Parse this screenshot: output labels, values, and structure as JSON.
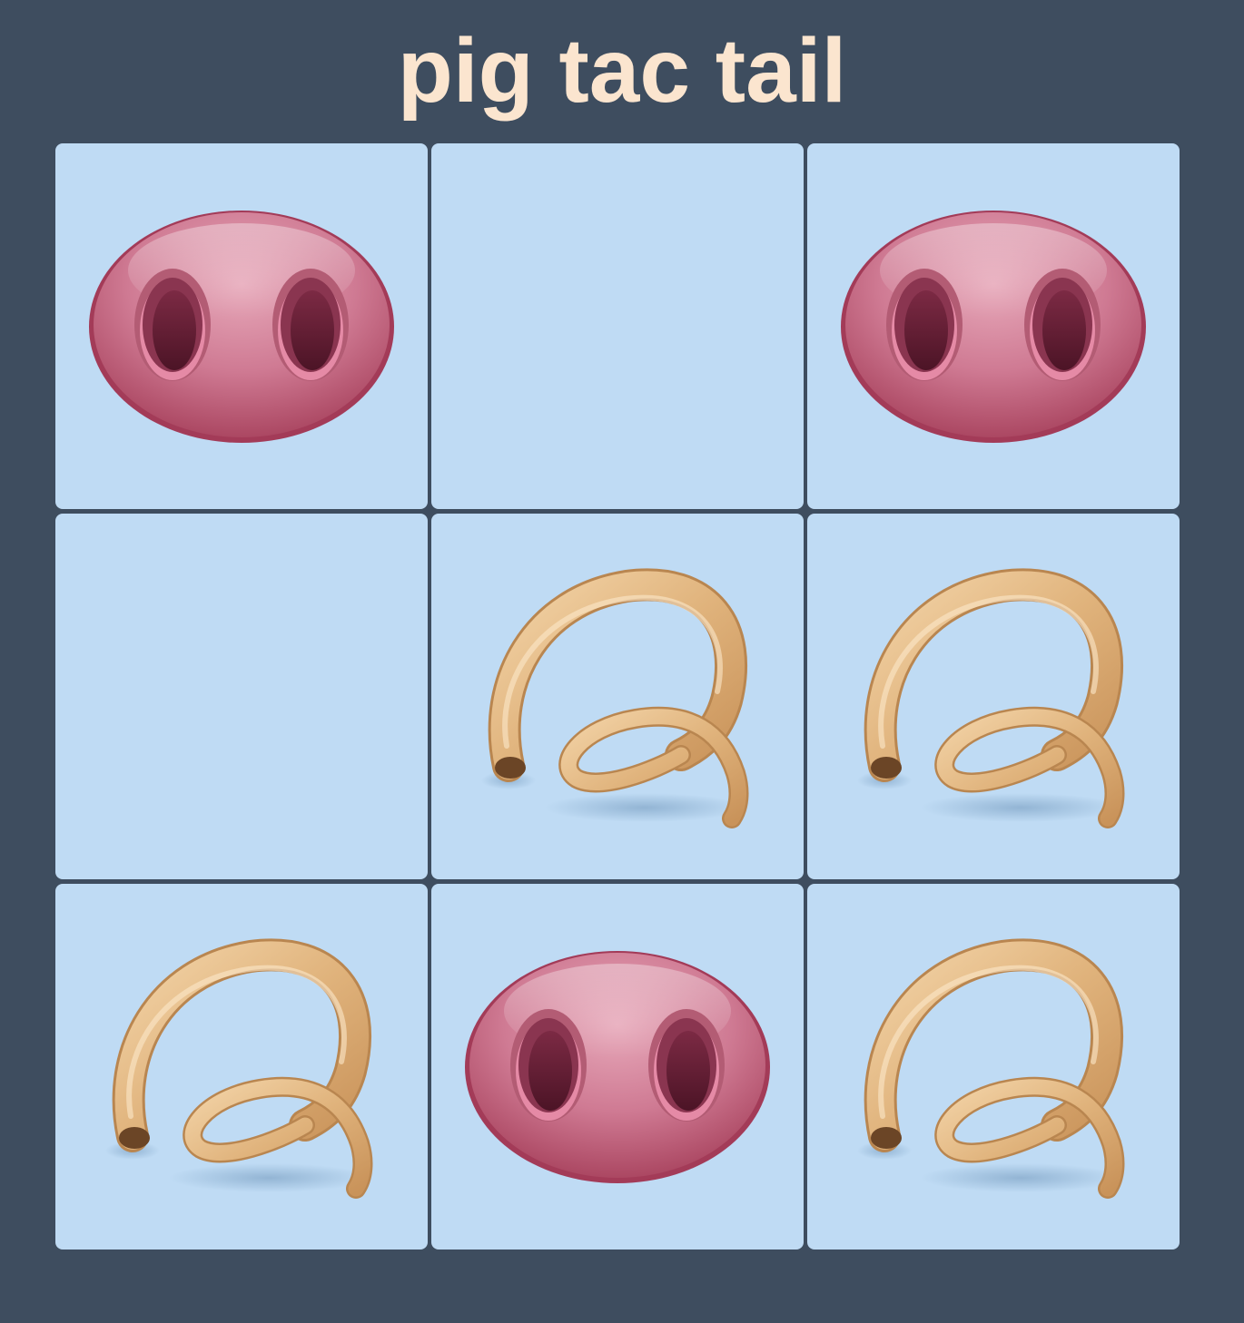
{
  "title": "pig tac tail",
  "colors": {
    "background": "#3e4d5f",
    "title": "#fbe5cf",
    "cell": "#bfdbf4",
    "snout": "#d4809a",
    "tail": "#e2b987"
  },
  "pieces": {
    "snout": "pig-snout-icon",
    "tail": "pig-tail-icon"
  },
  "board": [
    [
      "snout",
      "",
      "snout"
    ],
    [
      "",
      "tail",
      "tail"
    ],
    [
      "tail",
      "snout",
      "tail"
    ]
  ]
}
